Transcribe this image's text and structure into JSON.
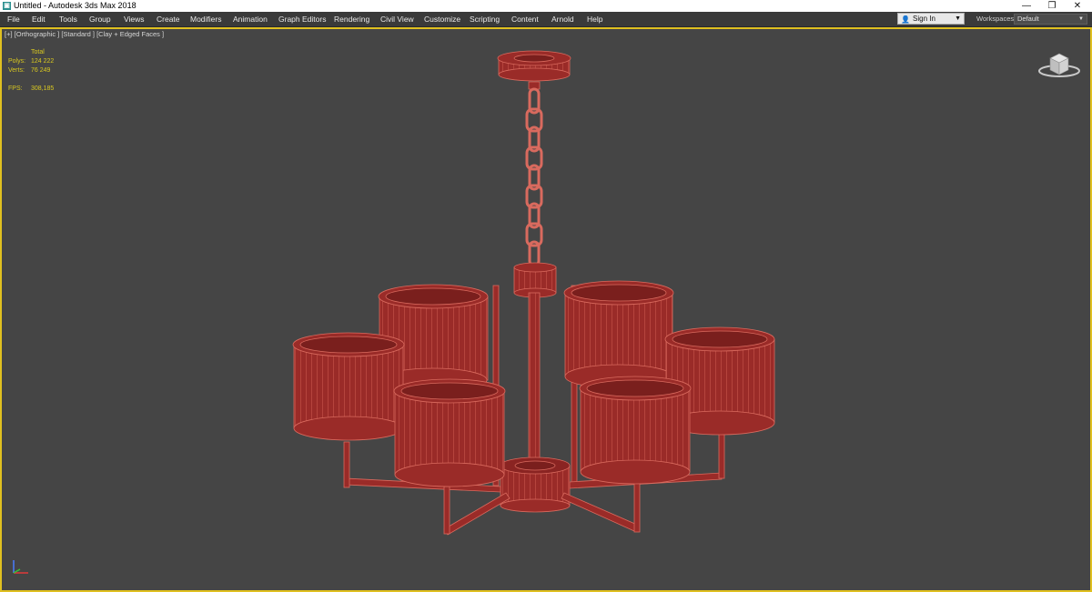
{
  "window": {
    "title": "Untitled - Autodesk 3ds Max 2018",
    "icon": "3ds-max-app-icon",
    "controls": {
      "minimize": "—",
      "restore": "❐",
      "close": "✕"
    }
  },
  "menu": {
    "items": [
      "File",
      "Edit",
      "Tools",
      "Group",
      "Views",
      "Create",
      "Modifiers",
      "Animation",
      "Graph Editors",
      "Rendering",
      "Civil View",
      "Customize",
      "Scripting",
      "Content",
      "Arnold",
      "Help"
    ],
    "sign_in": "Sign In",
    "workspaces_label": "Workspaces:",
    "workspaces_value": "Default"
  },
  "viewport": {
    "label": "[+] [Orthographic ] [Standard ] [Clay + Edged Faces ]",
    "stats": {
      "header": "Total",
      "polys_label": "Polys:",
      "polys_value": "124 222",
      "verts_label": "Verts:",
      "verts_value": "76 249",
      "fps_label": "FPS:",
      "fps_value": "308,185"
    }
  },
  "colors": {
    "viewport_bg": "#454545",
    "mesh_fill": "#9a2b28",
    "wire": "#d96a5e",
    "active_border": "#e0c020",
    "stats_text": "#d9c820"
  }
}
